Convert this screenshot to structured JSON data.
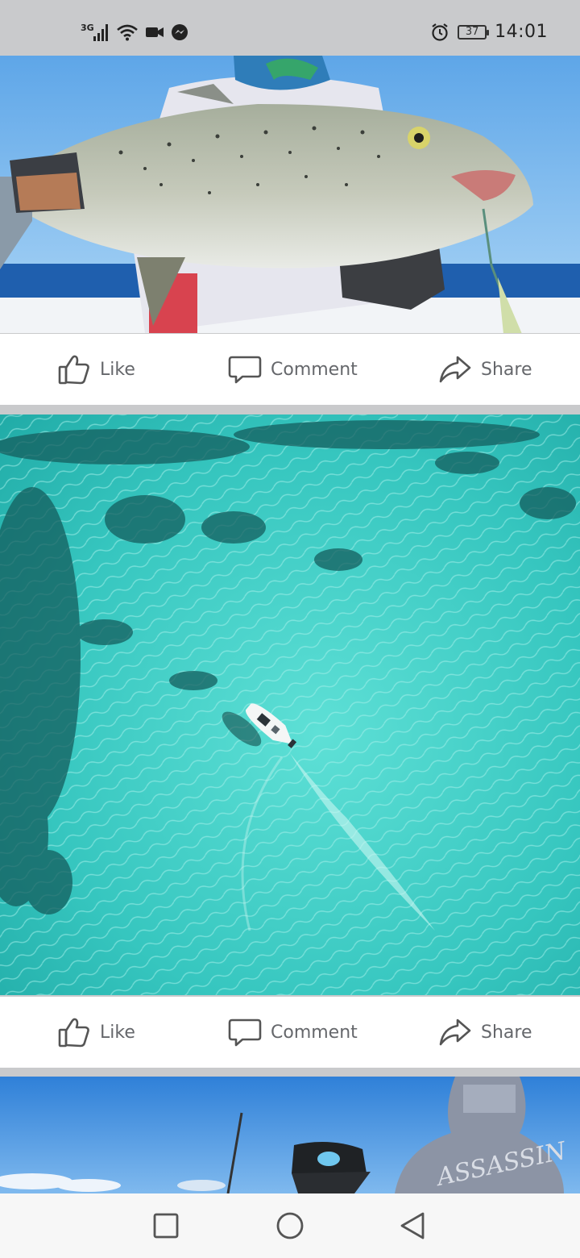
{
  "status_bar": {
    "network": "3G",
    "battery": "37",
    "time": "14:01",
    "icons": [
      "signal-icon",
      "wifi-icon",
      "video-call-icon",
      "messenger-icon",
      "alarm-icon",
      "battery-icon"
    ]
  },
  "feed": {
    "posts": [
      {
        "photo": "fish-catch-photo",
        "actions": {
          "like": "Like",
          "comment": "Comment",
          "share": "Share"
        }
      },
      {
        "photo": "reef-boat-aerial-photo",
        "actions": {
          "like": "Like",
          "comment": "Comment",
          "share": "Share"
        }
      },
      {
        "photo": "anglers-on-boat-photo"
      }
    ]
  },
  "nav_bar": {
    "icons": [
      "recents-square-icon",
      "home-circle-icon",
      "back-triangle-icon"
    ]
  },
  "colors": {
    "status_bg": "#c9cacc",
    "action_text": "#65676b",
    "reef_water": "#3fcfc6",
    "sea_blue": "#1f6fb3"
  }
}
